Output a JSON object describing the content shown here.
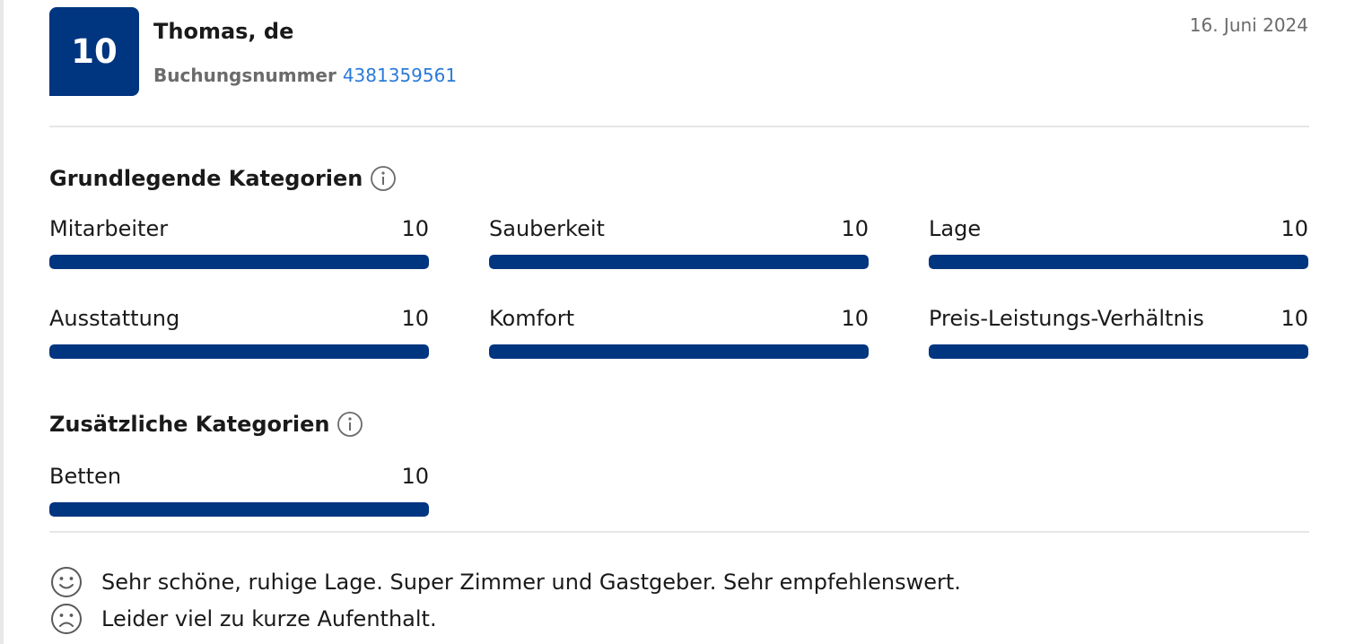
{
  "review": {
    "score": "10",
    "reviewer": "Thomas, de",
    "booking_label": "Buchungsnummer",
    "booking_number": "4381359561",
    "date": "16. Juni 2024"
  },
  "basic_categories": {
    "heading": "Grundlegende Kategorien",
    "items": [
      {
        "label": "Mitarbeiter",
        "score": "10",
        "fraction": 1.0
      },
      {
        "label": "Sauberkeit",
        "score": "10",
        "fraction": 1.0
      },
      {
        "label": "Lage",
        "score": "10",
        "fraction": 1.0
      },
      {
        "label": "Ausstattung",
        "score": "10",
        "fraction": 1.0
      },
      {
        "label": "Komfort",
        "score": "10",
        "fraction": 1.0
      },
      {
        "label": "Preis-Leistungs-Verhältnis",
        "score": "10",
        "fraction": 1.0
      }
    ]
  },
  "additional_categories": {
    "heading": "Zusätzliche Kategorien",
    "items": [
      {
        "label": "Betten",
        "score": "10",
        "fraction": 1.0
      }
    ]
  },
  "comments": {
    "positive": "Sehr schöne, ruhige Lage. Super Zimmer und Gastgeber. Sehr empfehlenswert.",
    "negative": "Leider viel zu kurze Aufenthalt."
  },
  "colors": {
    "brand": "#003580",
    "link": "#2a7ad8"
  },
  "icons": {
    "info": "info-icon",
    "positive": "smiley-face-icon",
    "negative": "sad-face-icon"
  }
}
